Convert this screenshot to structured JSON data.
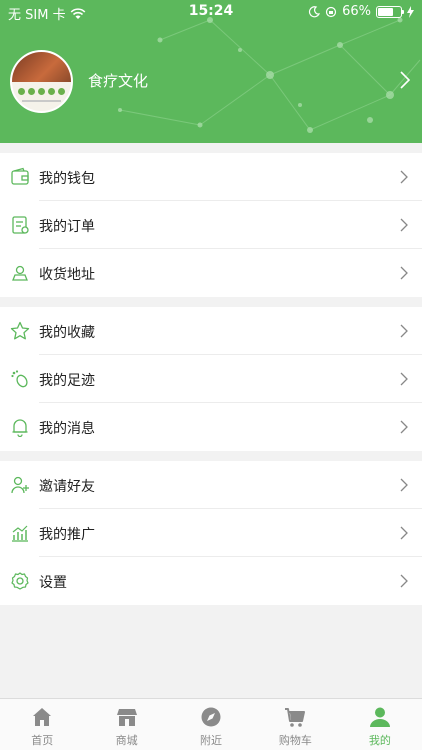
{
  "status_bar": {
    "carrier": "无 SIM 卡",
    "time": "15:24",
    "battery": "66%",
    "battery_level": 0.66
  },
  "header": {
    "username": "食疗文化"
  },
  "menu": {
    "group1": [
      {
        "label": "我的钱包",
        "icon": "wallet-icon"
      },
      {
        "label": "我的订单",
        "icon": "order-icon"
      },
      {
        "label": "收货地址",
        "icon": "address-icon"
      }
    ],
    "group2": [
      {
        "label": "我的收藏",
        "icon": "star-icon"
      },
      {
        "label": "我的足迹",
        "icon": "footprint-icon"
      },
      {
        "label": "我的消息",
        "icon": "bell-icon"
      }
    ],
    "group3": [
      {
        "label": "邀请好友",
        "icon": "invite-icon"
      },
      {
        "label": "我的推广",
        "icon": "chart-icon"
      },
      {
        "label": "设置",
        "icon": "gear-icon"
      }
    ]
  },
  "tabbar": {
    "items": [
      {
        "label": "首页",
        "icon": "home-icon",
        "active": false
      },
      {
        "label": "商城",
        "icon": "store-icon",
        "active": false
      },
      {
        "label": "附近",
        "icon": "compass-icon",
        "active": false
      },
      {
        "label": "购物车",
        "icon": "cart-icon",
        "active": false
      },
      {
        "label": "我的",
        "icon": "user-icon",
        "active": true
      }
    ]
  },
  "colors": {
    "brand": "#5cb85c",
    "inactive": "#8a8a8a",
    "background": "#f2f2f2"
  }
}
